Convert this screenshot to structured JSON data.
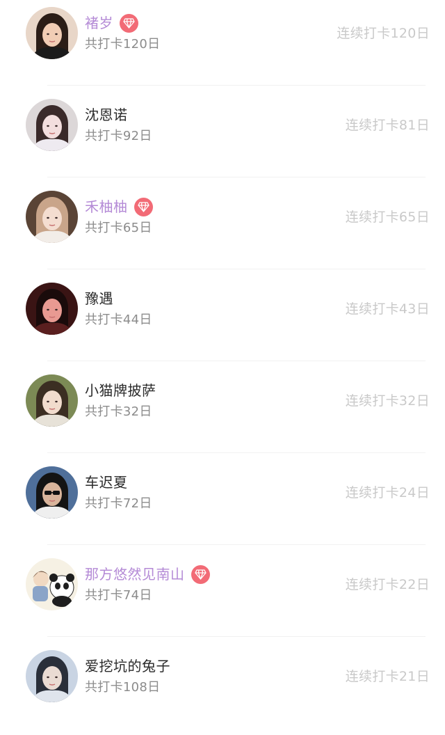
{
  "entries": [
    {
      "name": "褚岁",
      "total": "共打卡120日",
      "streak": "连续打卡120日",
      "vip": true,
      "avatar": {
        "bg": "#e8d6c8",
        "hair": "#2b1d17",
        "skin": "#f1cdb5",
        "cloth": "#1b1b1b",
        "icon": "avatar-woman-dark-hair"
      }
    },
    {
      "name": "沈恩诺",
      "total": "共打卡92日",
      "streak": "连续打卡81日",
      "vip": false,
      "avatar": {
        "bg": "#dcd7d8",
        "hair": "#3a2a2a",
        "skin": "#f3dede",
        "cloth": "#eeeaf0",
        "icon": "avatar-woman-light"
      }
    },
    {
      "name": "禾柚柚",
      "total": "共打卡65日",
      "streak": "连续打卡65日",
      "vip": true,
      "avatar": {
        "bg": "#5a4436",
        "hair": "#c9a58a",
        "skin": "#f4ddd0",
        "cloth": "#f2ede8",
        "icon": "avatar-woman-blonde"
      }
    },
    {
      "name": "豫遇",
      "total": "共打卡44日",
      "streak": "连续打卡43日",
      "vip": false,
      "avatar": {
        "bg": "#3a1414",
        "hair": "#1a0b0b",
        "skin": "#e89a92",
        "cloth": "#5a1f1f",
        "icon": "avatar-woman-red-light"
      }
    },
    {
      "name": "小猫牌披萨",
      "total": "共打卡32日",
      "streak": "连续打卡32日",
      "vip": false,
      "avatar": {
        "bg": "#7c8a55",
        "hair": "#3b2e22",
        "skin": "#f1dccd",
        "cloth": "#e7e2d8",
        "icon": "avatar-woman-garden"
      }
    },
    {
      "name": "车迟夏",
      "total": "共打卡72日",
      "streak": "连续打卡24日",
      "vip": false,
      "avatar": {
        "bg": "#4f6f9a",
        "hair": "#141414",
        "skin": "#d9b59c",
        "cloth": "#efefef",
        "icon": "avatar-man-sunglasses"
      }
    },
    {
      "name": "那方悠然见南山",
      "total": "共打卡74日",
      "streak": "连续打卡22日",
      "vip": true,
      "avatar": {
        "bg": "#f6f1e4",
        "hair": "#6a4e3a",
        "skin": "#f1d9c2",
        "cloth": "#2d2d2d",
        "icon": "avatar-panda-cartoon"
      }
    },
    {
      "name": "爱挖坑的兔子",
      "total": "共打卡108日",
      "streak": "连续打卡21日",
      "vip": false,
      "avatar": {
        "bg": "#c9d4e3",
        "hair": "#2a2f3a",
        "skin": "#eadbd3",
        "cloth": "#dfe4ec",
        "icon": "avatar-boy-portrait"
      }
    }
  ],
  "colors": {
    "vip_name": "#b48ad6",
    "normal_name": "#2a2a2a",
    "total_text": "#8c8c8c",
    "streak_text": "#c9c9c9",
    "vip_badge": "#f26b76"
  },
  "icons": {
    "vip_badge": "diamond-icon"
  }
}
